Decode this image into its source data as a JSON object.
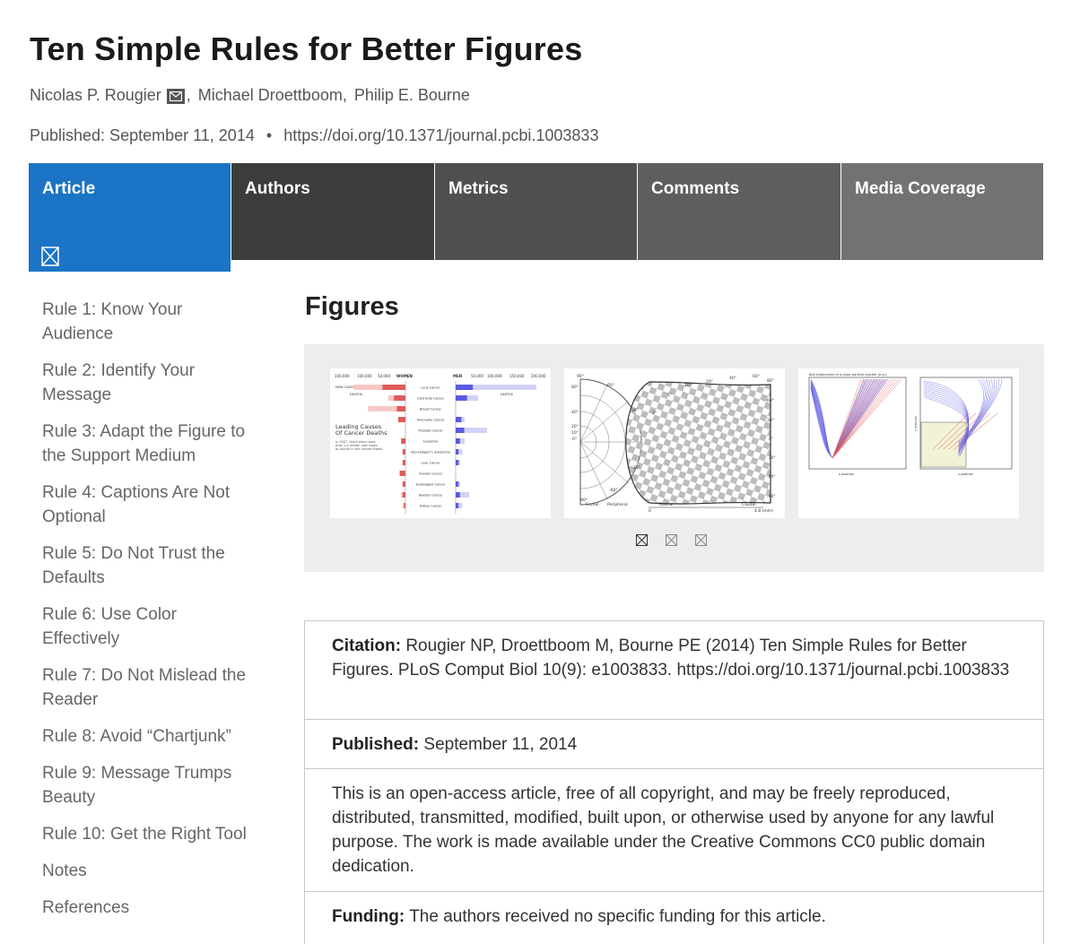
{
  "article": {
    "title": "Ten Simple Rules for Better Figures",
    "authors": [
      "Nicolas P. Rougier",
      "Michael Droettboom",
      "Philip E. Bourne"
    ],
    "published_line": "Published: September 11, 2014",
    "separator": "•",
    "doi_link": "https://doi.org/10.1371/journal.pcbi.1003833"
  },
  "tabs": [
    {
      "label": "Article"
    },
    {
      "label": "Authors"
    },
    {
      "label": "Metrics"
    },
    {
      "label": "Comments"
    },
    {
      "label": "Media Coverage"
    }
  ],
  "sidenav": {
    "items": [
      "Rule 1: Know Your Audience",
      "Rule 2: Identify Your Message",
      "Rule 3: Adapt the Figure to the Support Medium",
      "Rule 4: Captions Are Not Optional",
      "Rule 5: Do Not Trust the Defaults",
      "Rule 6: Use Color Effectively",
      "Rule 7: Do Not Mislead the Reader",
      "Rule 8: Avoid “Chartjunk”",
      "Rule 9: Message Trumps Beauty",
      "Rule 10: Get the Right Tool",
      "Notes",
      "References"
    ]
  },
  "figures": {
    "heading": "Figures",
    "fig1": {
      "col_left": "WOMEN",
      "col_right": "MEN",
      "ticks_left": [
        "100,000",
        "100,000",
        "50,000"
      ],
      "ticks_right": [
        "50,000",
        "100,000",
        "150,000",
        "200,000"
      ],
      "legend_new": "NEW CASES",
      "legend_deaths": "DEATHS",
      "caption_title": "Leading Causes Of Cancer Deaths",
      "caption_body": "In 2007, there were more than 1.4 million new cases of cancer in the United States.",
      "cancers": [
        "Lung Cancer",
        "Colorectal Cancer",
        "Breast Cancer",
        "Pancreatic Cancer",
        "Prostate Cancer",
        "Leukemia",
        "Non-Hodgkin's lymphoma",
        "Liver Cancer",
        "Ovarian Cancer",
        "Esophageal Cancer",
        "Bladder Cancer",
        "Kidney Cancer"
      ]
    },
    "fig2": {
      "left_ticks": [
        "80°",
        "60°",
        "40°",
        "20°",
        "10°",
        "0°",
        "90°",
        "-60°",
        "-30°",
        "30°"
      ],
      "right_ticks": [
        "80°",
        "60°",
        "30°",
        "0°",
        "-30°",
        "-60°",
        "-90°"
      ],
      "top_ticks": [
        "10°",
        "20°",
        "40°",
        "60°"
      ],
      "angle_labels": [
        "2°",
        "5°",
        "90°"
      ],
      "bottom_left": [
        "Foveal",
        "Peripheral"
      ],
      "bottom_right": [
        "Rostral",
        "Caudal"
      ],
      "scale_start": "0",
      "scale_end": "4.8 (mm)"
    },
    "fig3": {
      "title": "Ball trajectories of a close particle system (e.g.)",
      "xlabel": "x position",
      "ylabel": "y position"
    }
  },
  "info": {
    "citation_label": "Citation:",
    "citation_text": "Rougier NP, Droettboom M, Bourne PE (2014) Ten Simple Rules for Better Figures. PLoS Comput Biol 10(9): e1003833. https://doi.org/10.1371/journal.pcbi.1003833",
    "published_label": "Published:",
    "published_text": "September 11, 2014",
    "license_text": "This is an open-access article, free of all copyright, and may be freely reproduced, distributed, transmitted, modified, built upon, or otherwise used by anyone for any lawful purpose. The work is made available under the Creative Commons CC0 public domain dedication.",
    "funding_label": "Funding:",
    "funding_text": "The authors received no specific funding for this article."
  },
  "icons": {
    "mail": "mail-icon",
    "tab_placeholder": "broken-image-icon",
    "carousel_dot": "broken-image-icon"
  },
  "colors": {
    "active_tab": "#1b74c5",
    "women_bar": "#e05a5a",
    "men_bar": "#5a5ae0"
  }
}
